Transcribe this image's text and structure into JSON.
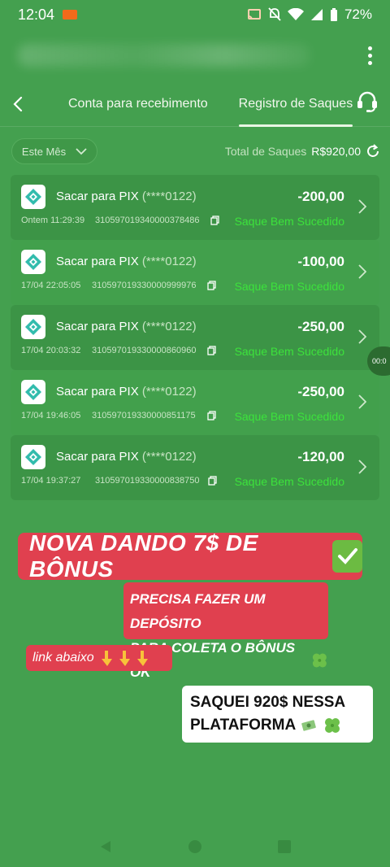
{
  "status_bar": {
    "time": "12:04",
    "battery": "72%"
  },
  "nav": {
    "tabs": [
      {
        "label": "Conta para recebimento"
      },
      {
        "label": "Registro de Saques"
      }
    ]
  },
  "filter": {
    "month_label": "Este Mês",
    "total_label": "Total de Saques",
    "total_value": "R$920,00"
  },
  "withdrawals": [
    {
      "title": "Sacar para PIX",
      "masked": "(****0122)",
      "amount": "-200,00",
      "date": "Ontem 11:29:39",
      "txid": "310597019340000378486",
      "status": "Saque Bem Sucedido"
    },
    {
      "title": "Sacar para PIX",
      "masked": "(****0122)",
      "amount": "-100,00",
      "date": "17/04 22:05:05",
      "txid": "310597019330000999976",
      "status": "Saque Bem Sucedido"
    },
    {
      "title": "Sacar para PIX",
      "masked": "(****0122)",
      "amount": "-250,00",
      "date": "17/04 20:03:32",
      "txid": "310597019330000860960",
      "status": "Saque Bem Sucedido"
    },
    {
      "title": "Sacar para PIX",
      "masked": "(****0122)",
      "amount": "-250,00",
      "date": "17/04 19:46:05",
      "txid": "310597019330000851175",
      "status": "Saque Bem Sucedido"
    },
    {
      "title": "Sacar para PIX",
      "masked": "(****0122)",
      "amount": "-120,00",
      "date": "17/04 19:37:27",
      "txid": "310597019330000838750",
      "status": "Saque Bem Sucedido"
    }
  ],
  "side_timer": "00:0",
  "promos": {
    "banner": "NOVA DANDO 7$ DE BÔNUS",
    "deposit_line1": "PRECISA FAZER UM DEPÓSITO",
    "deposit_line2": "PARA COLETA O BÔNUS OK",
    "link": "link abaixo",
    "withdraw_line1": "SAQUEI 920$ NESSA",
    "withdraw_line2": "PLATAFORMA"
  },
  "colors": {
    "background": "#44a04f",
    "card": "#3c9446",
    "success": "#3ce23c",
    "promo": "#e0404f"
  },
  "icons": [
    "back-arrow-icon",
    "headset-icon",
    "chevron-down-icon",
    "refresh-icon",
    "pix-icon",
    "copy-icon",
    "chevron-right-icon",
    "check-icon",
    "clover-icon",
    "pointing-down-icon",
    "money-icon"
  ]
}
